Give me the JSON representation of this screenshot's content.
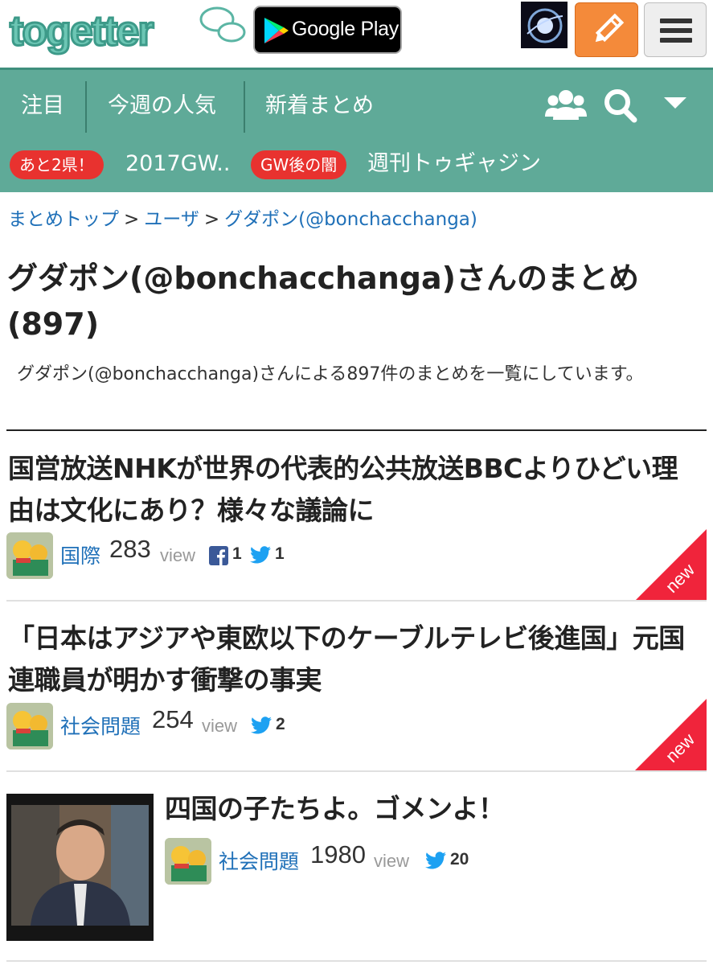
{
  "header": {
    "logo_text": "togetter",
    "google_play_label": "Google Play",
    "icons": [
      "togetter-logo",
      "google-play-icon",
      "user-avatar",
      "pencil-icon",
      "hamburger-menu-icon"
    ]
  },
  "nav": {
    "tabs": [
      {
        "label": "注目"
      },
      {
        "label": "今週の人気"
      },
      {
        "label": "新着まとめ"
      }
    ],
    "icons": [
      "users-icon",
      "search-icon",
      "caret-down-icon"
    ]
  },
  "trending": [
    {
      "badge": "あと2県！",
      "text": "2017GW.."
    },
    {
      "badge": "GW後の闇",
      "text": "週刊トゥギャジン"
    }
  ],
  "breadcrumb": {
    "items": [
      "まとめトップ",
      "ユーザ",
      "グダポン(@bonchacchanga)"
    ],
    "separator": ">"
  },
  "page": {
    "title": "グダポン(@bonchacchanga)さんのまとめ(897)",
    "description": "グダポン(@bonchacchanga)さんによる897件のまとめを一覧にしています。"
  },
  "items": [
    {
      "title": "国営放送NHKが世界の代表的公共放送BBCよりひどい理由は文化にあり？様々な議論に",
      "category": "国際",
      "views": "283",
      "view_label": "view",
      "facebook": "1",
      "twitter": "1",
      "new_label": "new"
    },
    {
      "title": "「日本はアジアや東欧以下のケーブルテレビ後進国」元国連職員が明かす衝撃の事実",
      "category": "社会問題",
      "views": "254",
      "view_label": "view",
      "twitter": "2",
      "new_label": "new"
    },
    {
      "title": "四国の子たちよ。ゴメンよ！",
      "category": "社会問題",
      "views": "1980",
      "view_label": "view",
      "twitter": "20"
    }
  ],
  "colors": {
    "nav_bg": "#5faa98",
    "badge_red": "#e8322f",
    "link_blue": "#1f70b8",
    "edit_orange": "#f48a3a",
    "twitter_blue": "#1da1f2",
    "facebook_blue": "#3b5998"
  }
}
